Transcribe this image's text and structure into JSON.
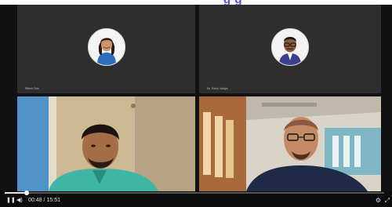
{
  "header": {
    "title_fragment": "g  g"
  },
  "tiles": [
    {
      "name": "Ritesh Chin",
      "kind": "avatar",
      "avatar_bg": "#2b6fbd"
    },
    {
      "name": "Mr. Rahul Vaidya",
      "kind": "avatar",
      "avatar_bg": "#e8e8e8"
    },
    {
      "name": "",
      "kind": "video"
    },
    {
      "name": "",
      "kind": "video"
    }
  ],
  "player": {
    "current_time": "00:48",
    "separator": "/",
    "duration": "15:51",
    "progress": 0.057,
    "play_icon": "pause-icon",
    "volume_icon": "volume-icon",
    "settings_icon": "gear-icon",
    "fullscreen_icon": "fullscreen-icon"
  },
  "meeting_controls": [
    "mic-icon",
    "camera-icon",
    "share-icon",
    "reactions-icon",
    "captions-icon",
    "raise-hand-icon",
    "chat-icon",
    "people-icon",
    "more-icon",
    "hangup-icon",
    "info-icon",
    "activities-icon"
  ],
  "colors": {
    "accent": "#5b4bd8",
    "tile_bg": "#2e2e2e",
    "hangup": "#9b2a2a"
  }
}
